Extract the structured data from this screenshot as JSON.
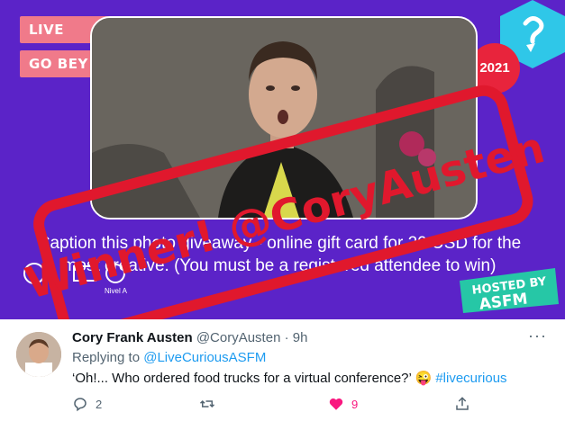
{
  "banner": {
    "pill_top": "LIVE CURIOU",
    "pill_bottom": "GO BEY",
    "year_badge": "2021",
    "caption": "Caption this photo giveaway - online gift card for 20 USD for the most creative. (You must be a registered attendee to win)",
    "hosted_line1": "HOSTED BY",
    "hosted_line2": "ASFM",
    "logo_label": "Nivel A"
  },
  "stamp": {
    "text": "Winner! @CoryAusten",
    "color": "#e0182d"
  },
  "tweet": {
    "display_name": "Cory Frank Austen",
    "handle": "@CoryAusten",
    "separator": "·",
    "time": "9h",
    "replying_prefix": "Replying to",
    "replying_to": "@LiveCuriousASFM",
    "text": "‘Oh!... Who ordered food trucks for a virtual conference?’",
    "emoji": "😜",
    "hashtag": "#livecurious",
    "reply_count": "2",
    "like_count": "9",
    "more_label": "···"
  },
  "colors": {
    "banner_bg": "#5b23c8",
    "pill": "#f07a8a",
    "accent_blue": "#1d9bf0",
    "like_red": "#f91880"
  }
}
